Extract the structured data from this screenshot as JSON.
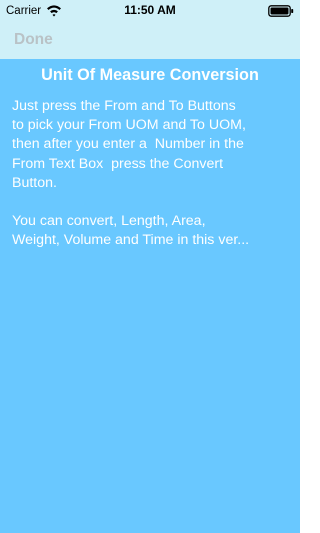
{
  "status_bar": {
    "carrier": "Carrier",
    "time": "11:50 AM",
    "wifi_icon": "wifi-icon",
    "battery_icon": "battery-icon"
  },
  "toolbar": {
    "done_label": "Done"
  },
  "main": {
    "title": "Unit Of Measure Conversion",
    "body": "Just press the From and To Buttons\nto pick your From UOM and To UOM,\nthen after you enter a  Number in the\nFrom Text Box  press the Convert\nButton.\n\nYou can convert, Length, Area,\nWeight, Volume and Time in this ver..."
  },
  "colors": {
    "status_bar_background": "#cff0f8",
    "content_background": "#69c8ff",
    "done_text": "#b9c2c6",
    "content_text": "#ffffff"
  }
}
